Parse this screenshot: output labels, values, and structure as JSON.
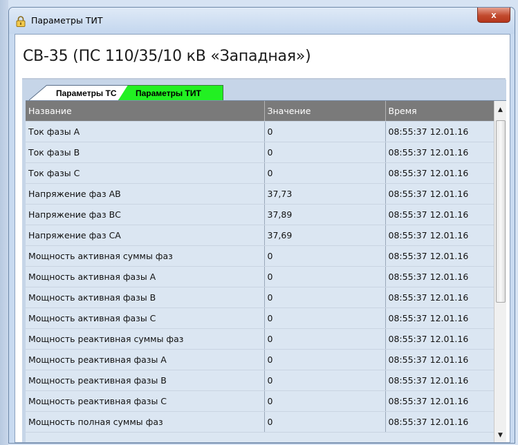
{
  "window": {
    "title": "Параметры ТИТ",
    "close_label": "x"
  },
  "heading": "СВ-35 (ПС 110/35/10 кВ «Западная»)",
  "tabs": [
    {
      "label": "Параметры ТС",
      "active": false
    },
    {
      "label": "Параметры ТИТ",
      "active": true,
      "color": "#22f022"
    }
  ],
  "table": {
    "columns": [
      "Название",
      "Значение",
      "Время"
    ],
    "rows": [
      [
        "Ток фазы А",
        "0",
        "08:55:37 12.01.16"
      ],
      [
        "Ток фазы В",
        "0",
        "08:55:37 12.01.16"
      ],
      [
        "Ток фазы С",
        "0",
        "08:55:37 12.01.16"
      ],
      [
        "Напряжение фаз АВ",
        "37,73",
        "08:55:37 12.01.16"
      ],
      [
        "Напряжение фаз ВС",
        "37,89",
        "08:55:37 12.01.16"
      ],
      [
        "Напряжение фаз СА",
        "37,69",
        "08:55:37 12.01.16"
      ],
      [
        "Мощность активная суммы фаз",
        "0",
        "08:55:37 12.01.16"
      ],
      [
        "Мощность активная фазы А",
        "0",
        "08:55:37 12.01.16"
      ],
      [
        "Мощность активная фазы В",
        "0",
        "08:55:37 12.01.16"
      ],
      [
        "Мощность активная фазы С",
        "0",
        "08:55:37 12.01.16"
      ],
      [
        "Мощность реактивная суммы фаз",
        "0",
        "08:55:37 12.01.16"
      ],
      [
        "Мощность реактивная фазы А",
        "0",
        "08:55:37 12.01.16"
      ],
      [
        "Мощность реактивная фазы В",
        "0",
        "08:55:37 12.01.16"
      ],
      [
        "Мощность реактивная фазы С",
        "0",
        "08:55:37 12.01.16"
      ],
      [
        "Мощность полная суммы фаз",
        "0",
        "08:55:37 12.01.16"
      ]
    ]
  },
  "icons": {
    "app": "lock-icon",
    "scroll_up": "scroll-up-arrow-icon",
    "scroll_down": "scroll-down-arrow-icon"
  }
}
